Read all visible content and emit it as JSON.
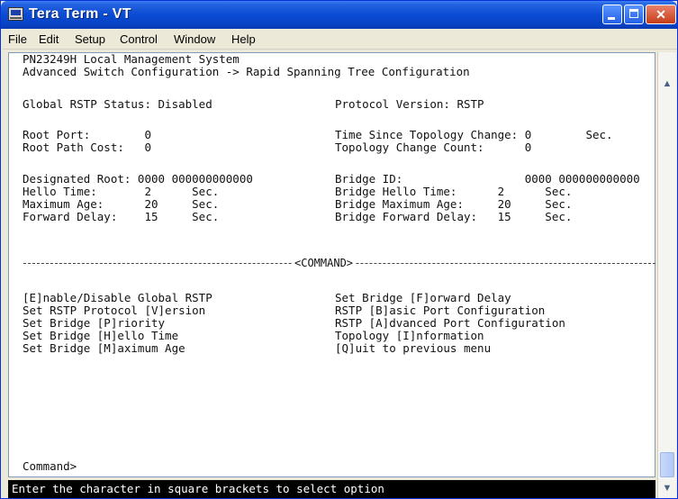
{
  "window": {
    "title": "Tera Term - VT",
    "icons": {
      "app": "terminal-app-icon",
      "minimize": "minimize-icon",
      "maximize": "maximize-icon",
      "close": "close-icon"
    }
  },
  "menu": [
    "File",
    "Edit",
    "Setup",
    "Control",
    "Window",
    "Help"
  ],
  "terminal": {
    "header_line1": "PN23249H Local Management System",
    "header_line2": "Advanced Switch Configuration -> Rapid Spanning Tree Configuration",
    "global_status": "Global RSTP Status: Disabled",
    "protocol_version": "Protocol Version: RSTP",
    "root_port": "Root Port:        0",
    "root_path_cost": "Root Path Cost:   0",
    "time_since_change": "Time Since Topology Change: 0        Sec.",
    "topology_change_count": "Topology Change Count:      0",
    "designated_root": "Designated Root: 0000 000000000000",
    "hello_time": "Hello Time:       2      Sec.",
    "maximum_age": "Maximum Age:      20     Sec.",
    "forward_delay": "Forward Delay:    15     Sec.",
    "bridge_id": "Bridge ID:                  0000 000000000000",
    "bridge_hello_time": "Bridge Hello Time:      2      Sec.",
    "bridge_max_age": "Bridge Maximum Age:     20     Sec.",
    "bridge_forward_delay": "Bridge Forward Delay:   15     Sec.",
    "command_label": "<COMMAND>",
    "cmd_left": [
      "[E]nable/Disable Global RSTP",
      "Set RSTP Protocol [V]ersion",
      "Set Bridge [P]riority",
      "Set Bridge [H]ello Time",
      "Set Bridge [M]aximum Age"
    ],
    "cmd_right": [
      "Set Bridge [F]orward Delay",
      "RSTP [B]asic Port Configuration",
      "RSTP [A]dvanced Port Configuration",
      "Topology [I]nformation",
      "[Q]uit to previous menu"
    ],
    "prompt": "Command>"
  },
  "status_bar": "Enter the character in square brackets to select option"
}
